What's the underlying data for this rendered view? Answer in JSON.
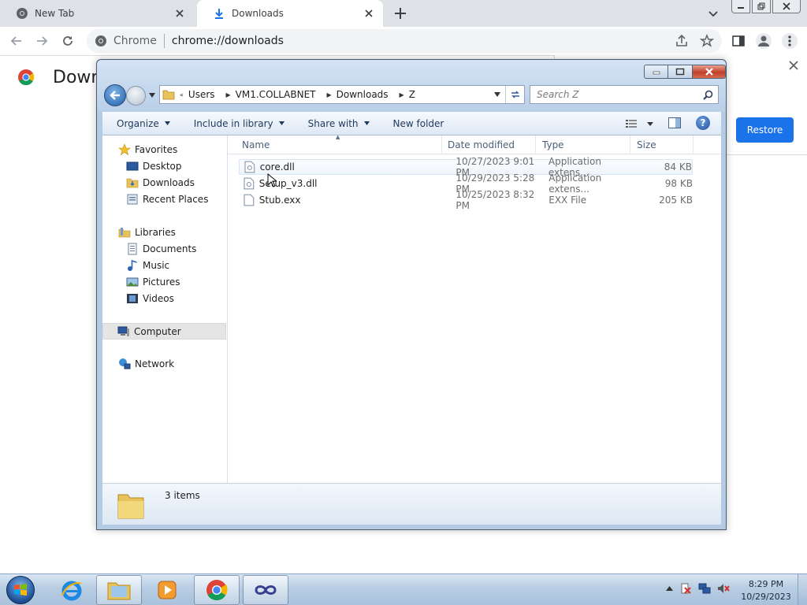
{
  "browser": {
    "tabs": [
      {
        "label": "New Tab",
        "icon": "chrome-icon",
        "active": false
      },
      {
        "label": "Downloads",
        "icon": "download-icon",
        "active": true
      }
    ],
    "omnibox": {
      "site_label": "Chrome",
      "url": "chrome://downloads"
    },
    "page": {
      "title": "Down"
    },
    "restore_label": "Restore"
  },
  "explorer": {
    "breadcrumb": [
      "Users",
      "VM1.COLLABNET",
      "Downloads",
      "Z"
    ],
    "search_placeholder": "Search Z",
    "commands": [
      "Organize",
      "Include in library",
      "Share with",
      "New folder"
    ],
    "help_label": "?",
    "nav": {
      "favorites": {
        "label": "Favorites",
        "items": [
          "Desktop",
          "Downloads",
          "Recent Places"
        ]
      },
      "libraries": {
        "label": "Libraries",
        "items": [
          "Documents",
          "Music",
          "Pictures",
          "Videos"
        ]
      },
      "computer": "Computer",
      "network": "Network"
    },
    "columns": [
      "Name",
      "Date modified",
      "Type",
      "Size"
    ],
    "files": [
      {
        "name": "core.dll",
        "date": "10/27/2023 9:01 PM",
        "type": "Application extens...",
        "size": "84 KB"
      },
      {
        "name": "Setup_v3.dll",
        "date": "10/29/2023 5:28 PM",
        "type": "Application extens...",
        "size": "98 KB"
      },
      {
        "name": "Stub.exx",
        "date": "10/25/2023 8:32 PM",
        "type": "EXX File",
        "size": "205 KB"
      }
    ],
    "status": "3 items"
  },
  "taskbar": {
    "apps": [
      "internet-explorer-icon",
      "windows-explorer-icon",
      "media-player-icon",
      "chrome-icon",
      "app-icon"
    ],
    "time": "8:29 PM",
    "date": "10/29/2023"
  },
  "colors": {
    "accent": "#1a73e8",
    "explorer_frame": "#b4cbe3"
  }
}
